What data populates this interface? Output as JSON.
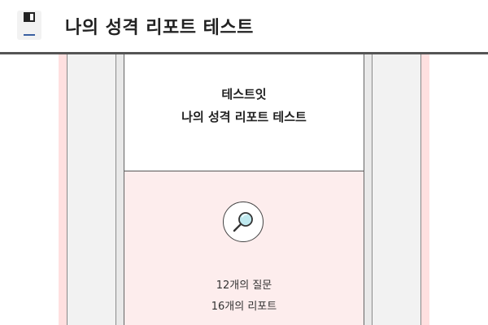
{
  "header": {
    "title": "나의 성격 리포트 테스트",
    "icon": "save-disk-icon"
  },
  "card": {
    "brand": "테스트잇",
    "title": "나의 성격 리포트 테스트",
    "icon": "search-icon",
    "questions_text": "12개의 질문",
    "reports_text": "16개의 리포트"
  },
  "colors": {
    "page_bg": "#ffe0e0",
    "card_bottom_bg": "#fdeded",
    "header_rule": "#555555",
    "lens_fill": "#bfe9ef"
  }
}
